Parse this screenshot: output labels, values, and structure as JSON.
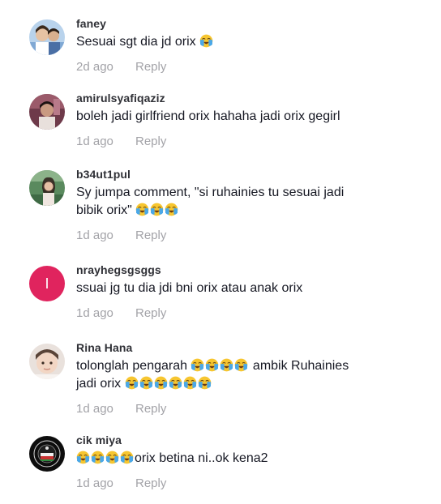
{
  "comments": [
    {
      "username": "faney",
      "text": "Sesuai sgt dia jd orix",
      "trailing_emojis": [
        "loudly-crying-face"
      ],
      "time": "2d ago",
      "reply": "Reply",
      "avatar": "photo"
    },
    {
      "username": "amirulsyafiqaziz",
      "text": "boleh jadi girlfriend orix hahaha jadi orix gegirl",
      "time": "1d ago",
      "reply": "Reply",
      "avatar": "photo"
    },
    {
      "username": "b34ut1pul",
      "text_line1": "Sy jumpa comment, \"si ruhainies tu sesuai jadi",
      "text_line2": "bibik orix\"",
      "trailing_emojis": [
        "loudly-crying-face",
        "loudly-crying-face",
        "loudly-crying-face"
      ],
      "time": "1d ago",
      "reply": "Reply",
      "avatar": "photo"
    },
    {
      "username": "nrayhegsgsggs",
      "text": "ssuai jg tu dia jdi bni orix atau anak orix",
      "time": "1d ago",
      "reply": "Reply",
      "avatar": "letter",
      "avatar_letter": "I",
      "avatar_color": "#e0245e"
    },
    {
      "username": "Rina Hana",
      "text_line1_a": "tolonglah pengarah",
      "text_line1_b": "ambik Ruhainies",
      "text_line2": "jadi orix",
      "emojis_mid": [
        "loudly-crying-face",
        "loudly-crying-face",
        "loudly-crying-face",
        "loudly-crying-face"
      ],
      "emojis_end": [
        "loudly-crying-face",
        "loudly-crying-face",
        "loudly-crying-face",
        "loudly-crying-face",
        "loudly-crying-face",
        "loudly-crying-face"
      ],
      "time": "1d ago",
      "reply": "Reply",
      "avatar": "photo"
    },
    {
      "username": "cik miya",
      "leading_emojis": [
        "loudly-crying-face",
        "loudly-crying-face",
        "loudly-crying-face",
        "loudly-crying-face"
      ],
      "text": "orix betina ni..ok kena2",
      "time": "1d ago",
      "reply": "Reply",
      "avatar": "logo"
    }
  ],
  "colors": {
    "username": "#2f3036",
    "text": "#161823",
    "meta": "#a3a3a8",
    "emoji_face": "#f7c630",
    "emoji_tears": "#4aa8e8"
  }
}
